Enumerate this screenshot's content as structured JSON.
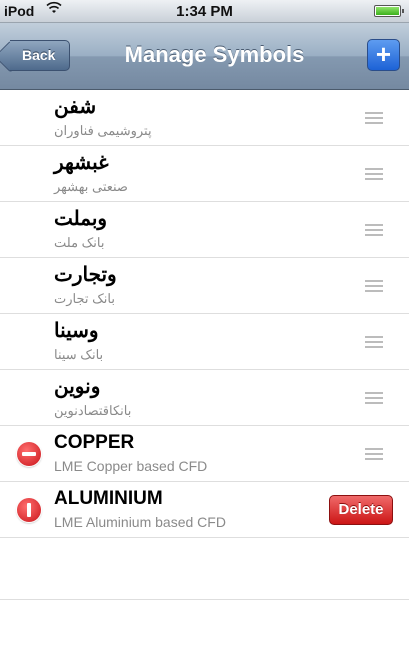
{
  "statusbar": {
    "carrier": "iPod",
    "wifi_icon": "wifi-icon",
    "time": "1:34 PM",
    "battery_icon": "battery-icon"
  },
  "navbar": {
    "back_label": "Back",
    "title": "Manage Symbols",
    "add_label": "+"
  },
  "symbols": [
    {
      "title": "شفن",
      "subtitle": "پتروشیمی فناوران"
    },
    {
      "title": "غبشهر",
      "subtitle": "صنعتی بهشهر"
    },
    {
      "title": "وبملت",
      "subtitle": "بانک ملت"
    },
    {
      "title": "وتجارت",
      "subtitle": "بانک تجارت"
    },
    {
      "title": "وسینا",
      "subtitle": "بانک سینا"
    },
    {
      "title": "ونوین",
      "subtitle": "بانکاقتصادنوین"
    },
    {
      "title": "COPPER",
      "subtitle": "LME Copper based CFD"
    },
    {
      "title": "ALUMINIUM",
      "subtitle": "LME Aluminium based CFD"
    }
  ],
  "delete_label": "Delete",
  "colors": {
    "delete_red": "#cc1515",
    "nav_blue": "#7589a1",
    "add_blue": "#1d62d6"
  }
}
